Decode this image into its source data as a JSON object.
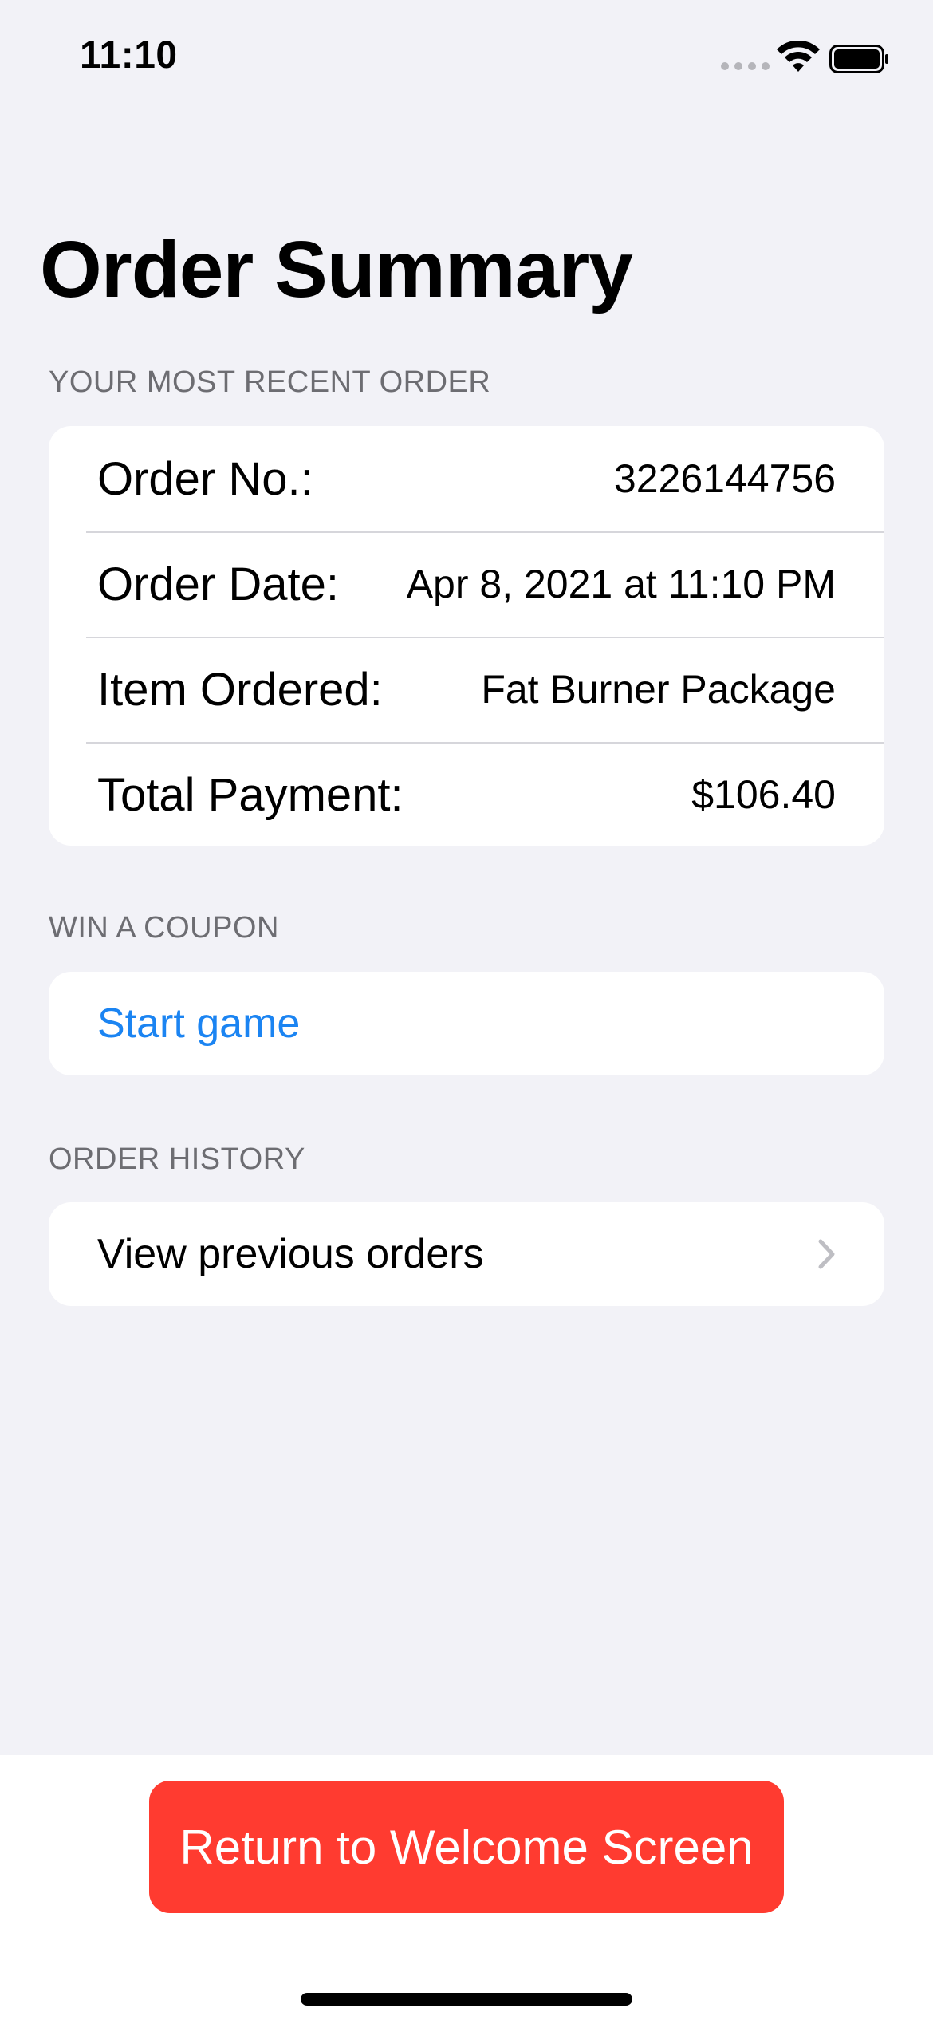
{
  "status_bar": {
    "time": "11:10",
    "icons": [
      "cellular-signal-icon",
      "wifi-icon",
      "battery-icon"
    ]
  },
  "page_title": "Order Summary",
  "recent_order": {
    "header": "YOUR MOST RECENT ORDER",
    "rows": [
      {
        "label": "Order No.:",
        "value": "3226144756"
      },
      {
        "label": "Order Date:",
        "value": "Apr 8, 2021 at 11:10 PM"
      },
      {
        "label": "Item Ordered:",
        "value": "Fat Burner Package"
      },
      {
        "label": "Total Payment:",
        "value": "$106.40"
      }
    ]
  },
  "coupon": {
    "header": "WIN A COUPON",
    "action_label": "Start game"
  },
  "history": {
    "header": "ORDER HISTORY",
    "link_label": "View previous orders",
    "icon": "chevron-right-icon"
  },
  "footer": {
    "button_label": "Return to Welcome Screen"
  },
  "colors": {
    "background": "#F2F2F7",
    "card": "#FFFFFF",
    "link": "#1B84F2",
    "destructive": "#FF3B30",
    "secondary_text": "#6D6D72"
  }
}
